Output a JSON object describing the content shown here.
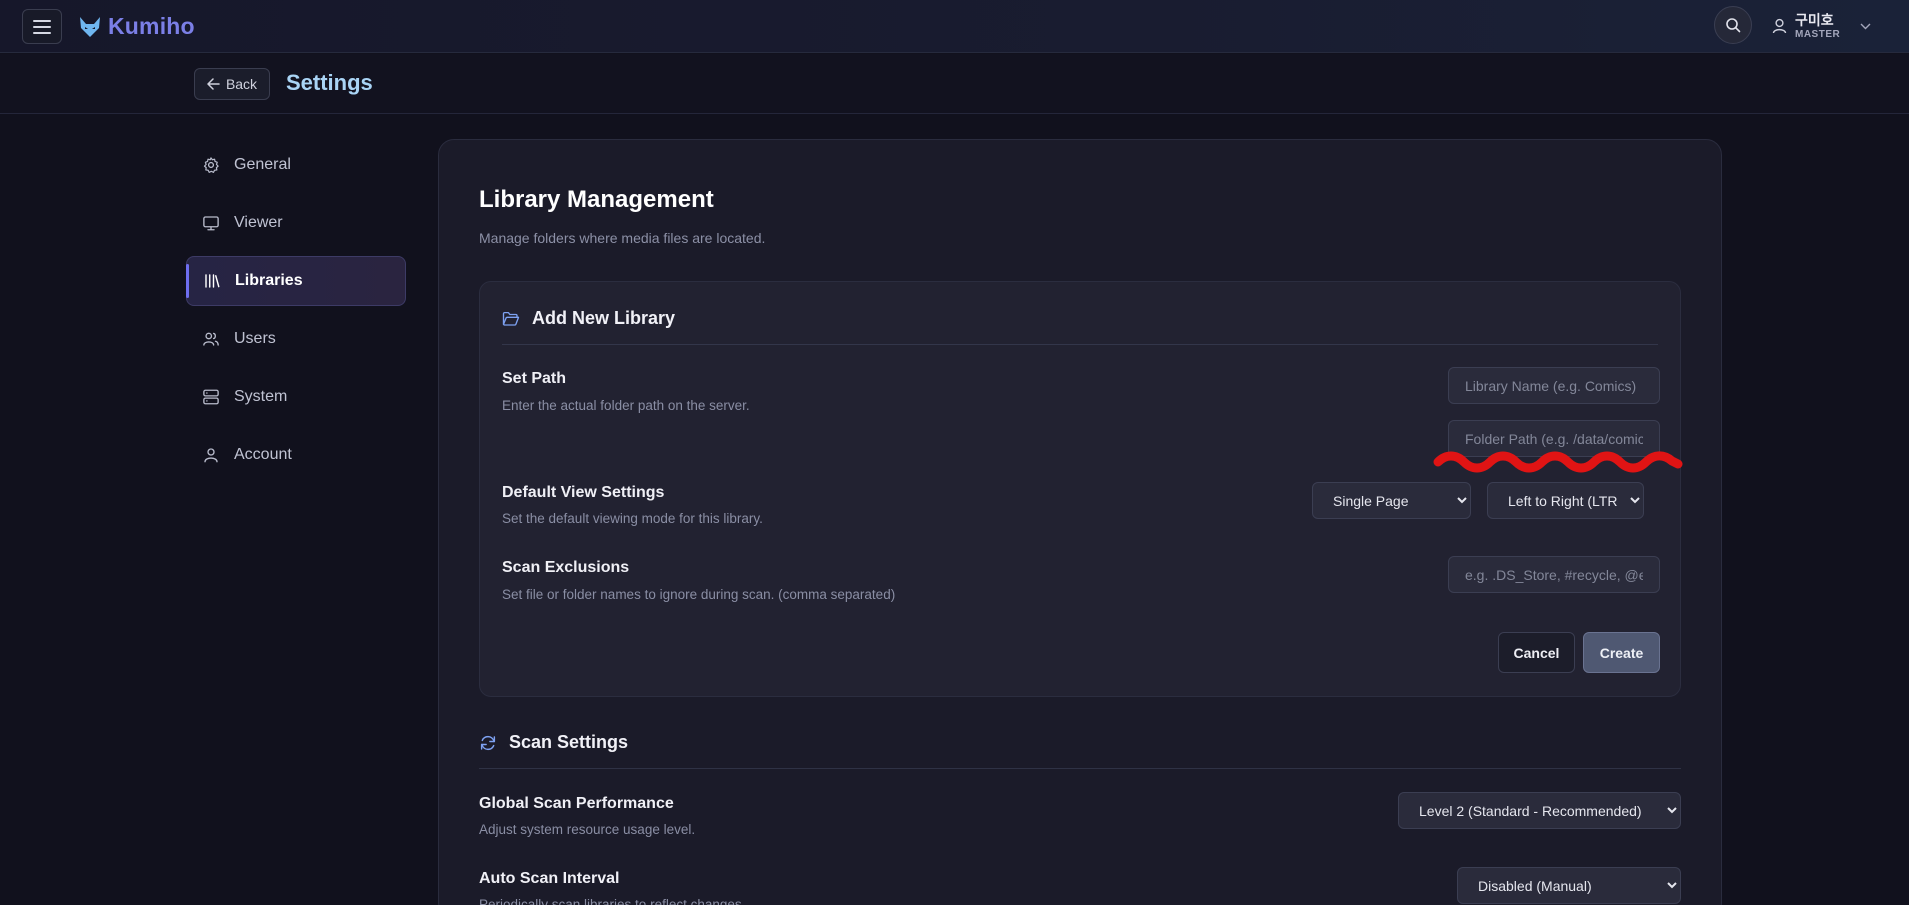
{
  "app": {
    "name": "Kumiho",
    "user_name": "구미호",
    "user_role": "MASTER"
  },
  "header": {
    "back_label": "Back",
    "title": "Settings"
  },
  "sidebar": {
    "items": [
      {
        "label": "General",
        "icon": "gear-icon",
        "active": false
      },
      {
        "label": "Viewer",
        "icon": "monitor-icon",
        "active": false
      },
      {
        "label": "Libraries",
        "icon": "library-icon",
        "active": true
      },
      {
        "label": "Users",
        "icon": "users-icon",
        "active": false
      },
      {
        "label": "System",
        "icon": "server-icon",
        "active": false
      },
      {
        "label": "Account",
        "icon": "user-icon",
        "active": false
      }
    ]
  },
  "main": {
    "title": "Library Management",
    "description": "Manage folders where media files are located.",
    "add_library": {
      "title": "Add New Library",
      "set_path": {
        "label": "Set Path",
        "description": "Enter the actual folder path on the server.",
        "name_placeholder": "Library Name (e.g. Comics)",
        "path_placeholder": "Folder Path (e.g. /data/comics)"
      },
      "default_view": {
        "label": "Default View Settings",
        "description": "Set the default viewing mode for this library.",
        "mode_value": "Single Page",
        "direction_value": "Left to Right (LTR)"
      },
      "scan_exclusions": {
        "label": "Scan Exclusions",
        "description": "Set file or folder names to ignore during scan. (comma separated)",
        "placeholder": "e.g. .DS_Store, #recycle, @eaDir"
      },
      "cancel_label": "Cancel",
      "create_label": "Create"
    },
    "scan_settings": {
      "title": "Scan Settings",
      "performance": {
        "label": "Global Scan Performance",
        "description": "Adjust system resource usage level.",
        "value": "Level 2 (Standard - Recommended)"
      },
      "interval": {
        "label": "Auto Scan Interval",
        "description": "Periodically scan libraries to reflect changes.",
        "value": "Disabled (Manual)"
      }
    }
  },
  "colors": {
    "accent": "#7b7fe6",
    "title_blue": "#a9d4f5",
    "annotation_red": "#e01414"
  }
}
